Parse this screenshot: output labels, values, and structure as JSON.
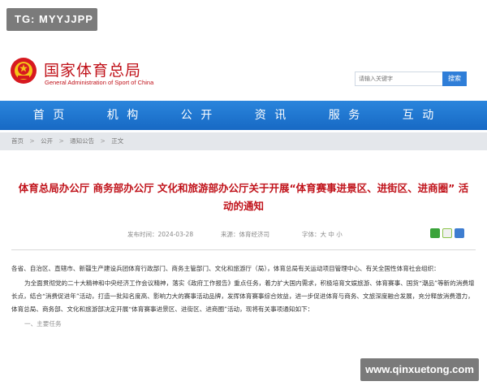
{
  "badge": {
    "text": "TG: MYYJJPP"
  },
  "header": {
    "emblem_icon": "national-emblem-icon",
    "title": "国家体育总局",
    "subtitle": "General Administration of Sport of China",
    "search": {
      "placeholder": "请输入关键字",
      "button_label": "搜索"
    }
  },
  "nav": {
    "items": [
      {
        "label": "首 页"
      },
      {
        "label": "机 构"
      },
      {
        "label": "公 开"
      },
      {
        "label": "资 讯"
      },
      {
        "label": "服 务"
      },
      {
        "label": "互 动"
      }
    ]
  },
  "breadcrumb": {
    "items": [
      "首页",
      "公开",
      "通知公告",
      "正文"
    ],
    "separator": ">"
  },
  "article": {
    "title_line1": "体育总局办公厅 商务部办公厅 文化和旅游部办公厅关于开展“体育赛事进景区、进街区、进商圈” 活",
    "title_line2": "动的通知",
    "date": "发布时间：2024-03-28",
    "source": "来源：体育经济司",
    "font_size": "字体：大 中 小",
    "share_icons": [
      "wechat-icon",
      "weibo-icon",
      "qzone-icon"
    ],
    "paragraphs": [
      "各省、自治区、直辖市、新疆生产建设兵团体育行政部门、商务主管部门、文化和旅游厅（局），体育总局有关运动项目管理中心、有关全国性体育社会组织：",
      "为全面贯彻党的二十大精神和中央经济工作会议精神，落实《政府工作报告》重点任务，着力扩大国内需求，积极培育文娱旅游、体育赛事、国货“潮品”等新的消费增长点，结合“消费促进年”活动，打造一批知名度高、影响力大的赛事活动品牌，发挥体育赛事综合效益，进一步促进体育与商务、文旅深度融合发展，充分释放消费潜力，体育总局、商务部、文化和旅游部决定开展“体育赛事进景区、进街区、进商圈”活动，现将有关事项通知如下：",
      "一、主要任务"
    ]
  },
  "watermark": {
    "text": "www.qinxuetong.com"
  },
  "colors": {
    "brand_red": "#c0121a",
    "nav_blue": "#1f78d1",
    "crumb_bg": "#e4e7eb"
  }
}
